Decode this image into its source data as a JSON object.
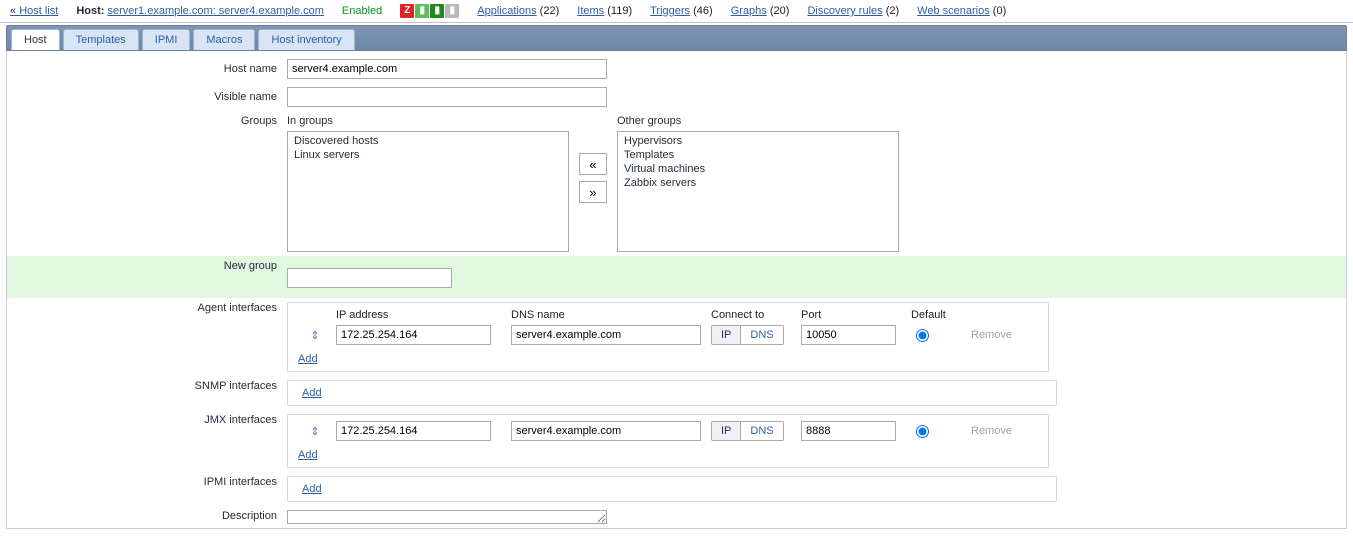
{
  "topbar": {
    "back_label": "Host list",
    "host_label": "Host:",
    "host_link": "server1.example.com: server4.example.com",
    "status": "Enabled",
    "icons": [
      "Z",
      "▮",
      "▮",
      "▮"
    ],
    "nav": {
      "applications": {
        "label": "Applications",
        "count": "22"
      },
      "items": {
        "label": "Items",
        "count": "119"
      },
      "triggers": {
        "label": "Triggers",
        "count": "46"
      },
      "graphs": {
        "label": "Graphs",
        "count": "20"
      },
      "discovery": {
        "label": "Discovery rules",
        "count": "2"
      },
      "web": {
        "label": "Web scenarios",
        "count": "0"
      }
    }
  },
  "tabs": {
    "host": "Host",
    "templates": "Templates",
    "ipmi": "IPMI",
    "macros": "Macros",
    "inventory": "Host inventory"
  },
  "form": {
    "hostname_label": "Host name",
    "hostname_value": "server4.example.com",
    "visiblename_label": "Visible name",
    "visiblename_value": "",
    "groups_label": "Groups",
    "in_groups_label": "In groups",
    "other_groups_label": "Other groups",
    "in_groups": [
      "Discovered hosts",
      "Linux servers"
    ],
    "other_groups": [
      "Hypervisors",
      "Templates",
      "Virtual machines",
      "Zabbix servers"
    ],
    "move_left": "«",
    "move_right": "»",
    "newgroup_label": "New group",
    "newgroup_value": "",
    "agent_label": "Agent interfaces",
    "snmp_label": "SNMP interfaces",
    "jmx_label": "JMX interfaces",
    "ipmi_if_label": "IPMI interfaces",
    "description_label": "Description",
    "description_value": ""
  },
  "interfaces": {
    "headers": {
      "ip": "IP address",
      "dns": "DNS name",
      "connect": "Connect to",
      "port": "Port",
      "default": "Default",
      "remove": "Remove"
    },
    "add_label": "Add",
    "connect_ip": "IP",
    "connect_dns": "DNS",
    "agent": [
      {
        "ip": "172.25.254.164",
        "dns": "server4.example.com",
        "connect": "IP",
        "port": "10050",
        "default": true
      }
    ],
    "snmp": [],
    "jmx": [
      {
        "ip": "172.25.254.164",
        "dns": "server4.example.com",
        "connect": "IP",
        "port": "8888",
        "default": true
      }
    ],
    "ipmi_if": []
  }
}
